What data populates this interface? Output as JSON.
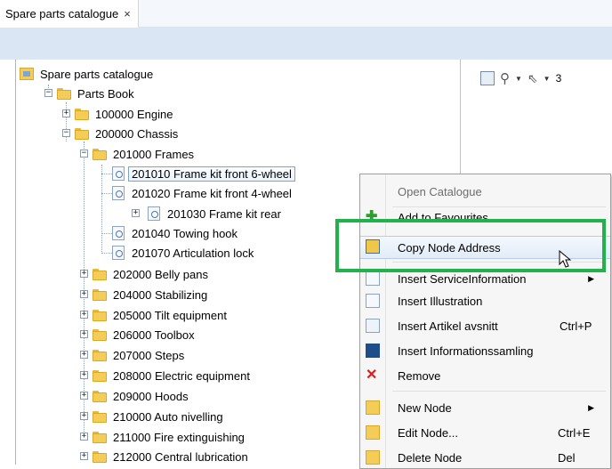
{
  "tab": {
    "title": "Spare parts catalogue",
    "close": "×"
  },
  "tree": {
    "root": "Spare parts catalogue",
    "book": "Parts Book",
    "nodes": {
      "engine": "100000 Engine",
      "chassis": "200000 Chassis",
      "frames": "201000 Frames",
      "f201010": "201010 Frame kit front 6-wheel",
      "f201020": "201020 Frame kit front 4-wheel",
      "f201030": "201030 Frame kit rear",
      "f201040": "201040 Towing hook",
      "f201070": "201070 Articulation lock",
      "c202000": "202000 Belly pans",
      "c204000": "204000 Stabilizing",
      "c205000": "205000 Tilt equipment",
      "c206000": "206000 Toolbox",
      "c207000": "207000 Steps",
      "c208000": "208000 Electric equipment",
      "c209000": "209000 Hoods",
      "c210000": "210000 Auto nivelling",
      "c211000": "211000 Fire extinguishing",
      "c212000": "212000 Central lubrication"
    }
  },
  "right_toolbar": {
    "number": "3"
  },
  "menu": {
    "open_catalogue": "Open Catalogue",
    "add_favourites": "Add to Favourites...",
    "copy_node_address": "Copy Node Address",
    "insert_serviceinformation": "Insert ServiceInformation",
    "insert_illustration": "Insert Illustration",
    "insert_artikel": "Insert Artikel avsnitt",
    "insert_artikel_sc": "Ctrl+P",
    "insert_informationssamling": "Insert Informationssamling",
    "remove": "Remove",
    "new_node": "New Node",
    "edit_node": "Edit Node...",
    "edit_node_sc": "Ctrl+E",
    "delete_node": "Delete Node",
    "delete_node_sc": "Del"
  },
  "colors": {
    "highlight_box": "#21b24b",
    "band": "#dbe6f4"
  }
}
